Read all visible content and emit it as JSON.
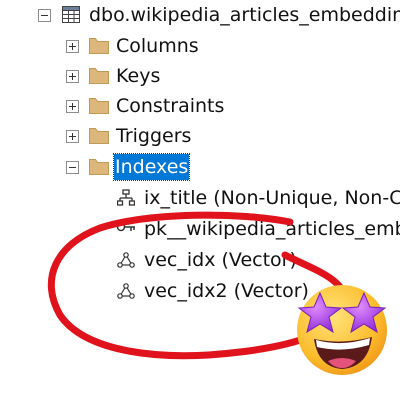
{
  "tree": {
    "table_node": {
      "label": "dbo.wikipedia_articles_embeddings",
      "icon": "table-icon",
      "expanded": true
    },
    "folders": [
      {
        "label": "Columns",
        "icon": "folder-icon",
        "expanded": false
      },
      {
        "label": "Keys",
        "icon": "folder-icon",
        "expanded": false
      },
      {
        "label": "Constraints",
        "icon": "folder-icon",
        "expanded": false
      },
      {
        "label": "Triggers",
        "icon": "folder-icon",
        "expanded": false
      },
      {
        "label": "Indexes",
        "icon": "folder-icon",
        "expanded": true,
        "selected": true
      }
    ],
    "indexes": [
      {
        "label": "ix_title (Non-Unique, Non-Clustered)",
        "icon": "index-icon"
      },
      {
        "label": "pk__wikipedia_articles_embeddings",
        "icon": "primary-key-icon"
      },
      {
        "label": "vec_idx (Vector)",
        "icon": "vector-index-icon"
      },
      {
        "label": "vec_idx2 (Vector)",
        "icon": "vector-index-icon"
      }
    ]
  },
  "annotation": {
    "circle_color": "#e0121c",
    "emoji": "star-struck-emoji-icon"
  },
  "colors": {
    "selection": "#0078d7",
    "folder": "#dcb67a"
  }
}
